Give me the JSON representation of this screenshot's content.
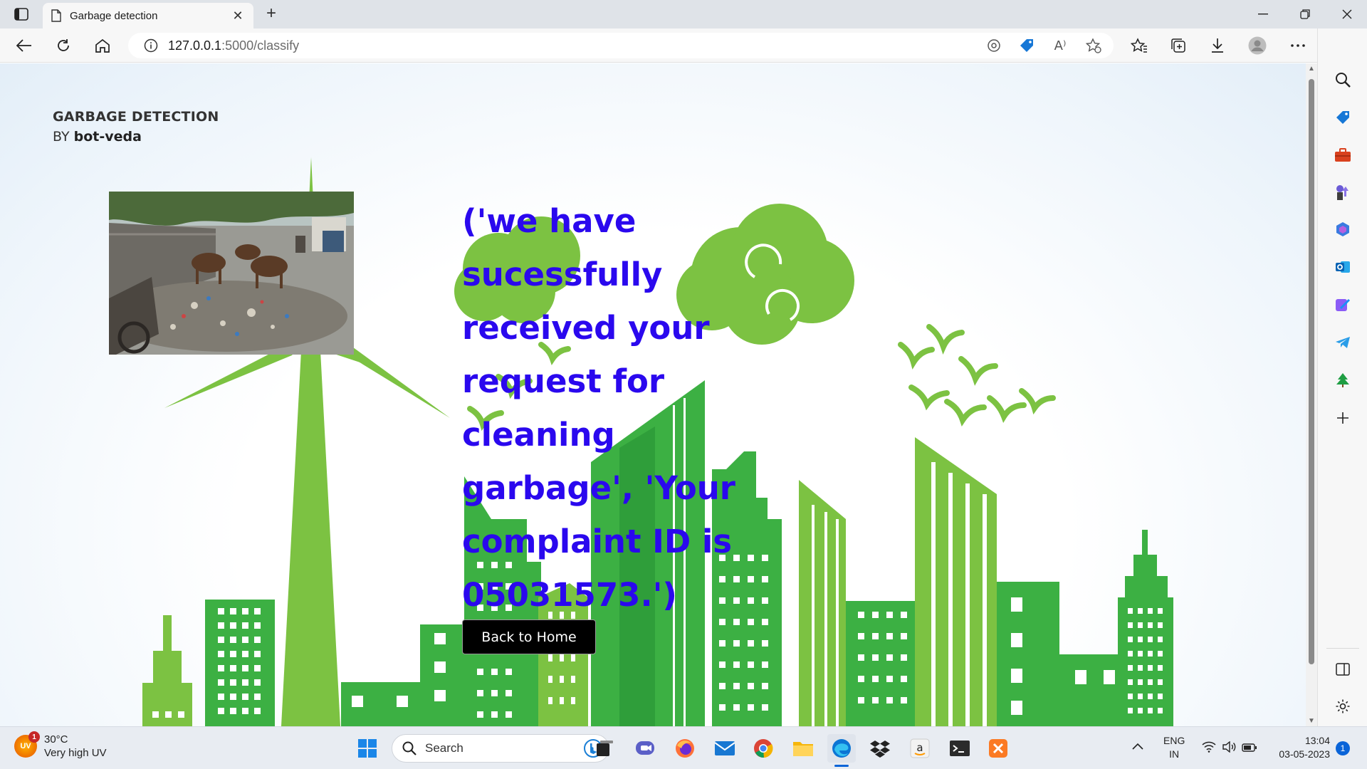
{
  "browser": {
    "tab": {
      "title": "Garbage detection",
      "close_glyph": "✕",
      "icon": "page-icon"
    },
    "new_tab_glyph": "+",
    "window_controls": [
      "minimize",
      "restore",
      "close"
    ],
    "address": {
      "host": "127.0.0.1",
      "path": ":5000/classify"
    },
    "toolbar_icons": [
      "back-icon",
      "refresh-icon",
      "home-icon",
      "site-info-icon",
      "location-icon",
      "coupon-icon",
      "read-aloud-icon",
      "add-favorite-icon",
      "favorites-icon",
      "collections-icon",
      "downloads-icon",
      "profile-icon",
      "more-icon",
      "bing-chat-icon"
    ],
    "read_aloud_label": "A⁾"
  },
  "page": {
    "brand_name": "GARBAGE DETECTION",
    "by_prefix": "BY ",
    "by_name": "bot-veda",
    "message": "('we have sucessfully received your request for cleaning garbage', 'Your complaint ID is 05031573.')",
    "back_button": "Back to Home",
    "colors": {
      "message": "#2a08ee",
      "city_green": "#3cb043",
      "light_green": "#7cc242",
      "button_bg": "#000000"
    }
  },
  "sidebar": {
    "icons": [
      "search-icon",
      "shopping-tag-icon",
      "tools-briefcase-icon",
      "games-icon",
      "microsoft-365-icon",
      "outlook-icon",
      "designer-icon",
      "telegram-icon",
      "tree-icon",
      "add-icon"
    ],
    "bottom_icons": [
      "split-screen-icon",
      "settings-icon"
    ]
  },
  "taskbar": {
    "weather": {
      "badge": "UV",
      "badge_count": "1",
      "temp": "30°C",
      "desc": "Very high UV"
    },
    "search_label": "Search",
    "apps": [
      "windows-start-icon",
      "task-view-icon",
      "teams-chat-icon",
      "firefox-icon",
      "mail-icon",
      "chrome-icon",
      "file-explorer-icon",
      "edge-icon",
      "dropbox-icon",
      "amazon-icon",
      "terminal-icon",
      "xampp-icon"
    ],
    "tray": {
      "lang_top": "ENG",
      "lang_bottom": "IN",
      "time": "13:04",
      "date": "03-05-2023",
      "notification_count": "1"
    }
  }
}
